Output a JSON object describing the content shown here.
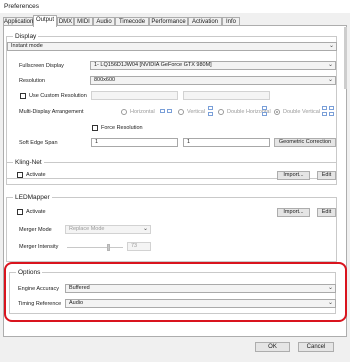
{
  "window": {
    "title": "Preferences"
  },
  "tabs": [
    "Application",
    "Output",
    "DMX",
    "MIDI",
    "Audio",
    "Timecode",
    "Performance",
    "Activation",
    "Info"
  ],
  "display": {
    "legend": "Display",
    "mode": "Instant mode",
    "fullscreen_label": "Fullscreen Display",
    "fullscreen_value": "1- LQ156D1JW04 [NVIDIA GeForce GTX 980M]",
    "resolution_label": "Resolution",
    "resolution_value": "800x600",
    "custom_resolution_label": "Use Custom Resolution",
    "multi_label": "Multi-Display Arrangement",
    "horizontal_label": "Horizontal",
    "vertical_label": "Vertical",
    "double_horizontal_label": "Double Horizontal",
    "double_vertical_label": "Double Vertical",
    "force_resolution_label": "Force Resolution",
    "soft_edge_label": "Soft Edge Span",
    "soft_edge_value_1": "1",
    "soft_edge_value_2": "1",
    "geometric_correction_label": "Geometric Correction"
  },
  "kling_net": {
    "legend": "Kling-Net",
    "activate_label": "Activate",
    "import_label": "Import...",
    "edit_label": "Edit"
  },
  "ledmapper": {
    "legend": "LEDMapper",
    "activate_label": "Activate",
    "import_label": "Import...",
    "edit_label": "Edit",
    "merger_mode_label": "Merger Mode",
    "merger_mode_value": "Replace Mode",
    "merger_intensity_label": "Merger Intensity",
    "merger_intensity_value": "73"
  },
  "options": {
    "legend": "Options",
    "engine_accuracy_label": "Engine Accuracy",
    "engine_accuracy_value": "Buffered",
    "timing_reference_label": "Timing Reference",
    "timing_reference_value": "Audio"
  },
  "footer": {
    "ok_label": "OK",
    "cancel_label": "Cancel"
  },
  "colors": {
    "highlight": "#d9141e",
    "panel": "#ffffff",
    "background": "#f0f0f0"
  }
}
